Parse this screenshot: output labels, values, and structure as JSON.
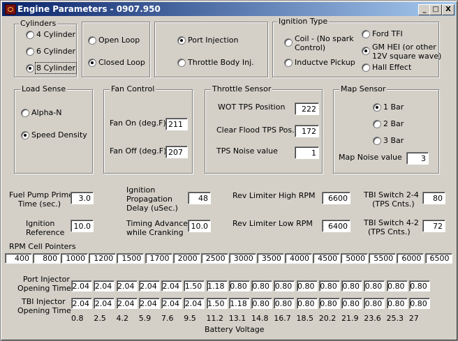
{
  "window": {
    "title": "Engine Parameters - 0907.950"
  },
  "title_buttons": {
    "minimize": "_",
    "maximize": "□",
    "close": "X"
  },
  "cylinders": {
    "label": "Cylinders",
    "options": [
      "4 Cylinder",
      "6 Cylinder",
      "8 Cylinder"
    ],
    "selected": "8 Cylinder"
  },
  "loop": {
    "options": [
      "Open Loop",
      "Closed Loop"
    ],
    "selected": "Closed Loop"
  },
  "injection": {
    "options": [
      "Port Injection",
      "Throttle Body Inj."
    ],
    "selected": "Port Injection"
  },
  "ignition_type": {
    "label": "Ignition Type",
    "coil_line1": "Coil - (No spark",
    "coil_line2": "Control)",
    "inductive": "Inductve Pickup",
    "ford": "Ford TFI",
    "gm_line1": "GM HEI (or other",
    "gm_line2": "12V square wave)",
    "hall": "Hall Effect",
    "selected": "GM HEI (or other 12V square wave)"
  },
  "load_sense": {
    "label": "Load Sense",
    "options": [
      "Alpha-N",
      "Speed Density"
    ],
    "selected": "Speed Density"
  },
  "fan_control": {
    "label": "Fan Control",
    "fan_on_label": "Fan On (deg.F)",
    "fan_on_value": "211",
    "fan_off_label": "Fan Off (deg.F)",
    "fan_off_value": "207"
  },
  "throttle_sensor": {
    "label": "Throttle Sensor",
    "wot_label": "WOT TPS Position",
    "wot_value": "222",
    "clear_flood_label": "Clear Flood TPS Pos.",
    "clear_flood_value": "172",
    "noise_label": "TPS Noise value",
    "noise_value": "1"
  },
  "map_sensor": {
    "label": "Map Sensor",
    "options": [
      "1 Bar",
      "2 Bar",
      "3 Bar"
    ],
    "selected": "1 Bar",
    "noise_label": "Map Noise value",
    "noise_value": "3"
  },
  "params": {
    "fuel_pump_line1": "Fuel Pump Prime",
    "fuel_pump_line2": "Time (sec.)",
    "fuel_pump_value": "3.0",
    "ign_prop_line1": "Ignition",
    "ign_prop_line2": "Propagation",
    "ign_prop_line3": "Delay (uSec.)",
    "ign_prop_value": "48",
    "rev_high_label": "Rev Limiter High RPM",
    "rev_high_value": "6600",
    "tbi24_line1": "TBI Switch 2-4",
    "tbi24_line2": "(TPS Cnts.)",
    "tbi24_value": "80",
    "ign_ref_line1": "Ignition",
    "ign_ref_line2": "Reference",
    "ign_ref_value": "10.0",
    "timing_line1": "Timing Advance",
    "timing_line2": "while Cranking",
    "timing_value": "10.0",
    "rev_low_label": "Rev Limiter Low RPM",
    "rev_low_value": "6400",
    "tbi42_line1": "TBI Switch 4-2",
    "tbi42_line2": "(TPS Cnts.)",
    "tbi42_value": "72"
  },
  "rpm_cells": {
    "label": "RPM Cell Pointers",
    "values": [
      "400",
      "800",
      "1000",
      "1200",
      "1500",
      "1700",
      "2000",
      "2500",
      "3000",
      "3500",
      "4000",
      "4500",
      "5000",
      "5500",
      "6000",
      "6500"
    ]
  },
  "injector_table": {
    "port_line1": "Port Injector",
    "port_line2": "Opening Time",
    "tbi_line1": "TBI Injector",
    "tbi_line2": "Opening Time",
    "port_values": [
      "2.04",
      "2.04",
      "2.04",
      "2.04",
      "2.04",
      "1.50",
      "1.18",
      "0.80",
      "0.80",
      "0.80",
      "0.80",
      "0.80",
      "0.80",
      "0.80",
      "0.80",
      "0.80"
    ],
    "tbi_values": [
      "2.04",
      "2.04",
      "2.04",
      "2.04",
      "2.04",
      "2.04",
      "1.50",
      "1.18",
      "0.80",
      "0.80",
      "0.80",
      "0.80",
      "0.80",
      "0.80",
      "0.80",
      "0.80"
    ],
    "voltages": [
      "0.8",
      "2.5",
      "4.2",
      "5.9",
      "7.6",
      "9.5",
      "11.2",
      "13.1",
      "14.8",
      "16.7",
      "18.5",
      "20.2",
      "21.9",
      "23.6",
      "25.3",
      "27"
    ],
    "axis_label": "Battery Voltage"
  }
}
